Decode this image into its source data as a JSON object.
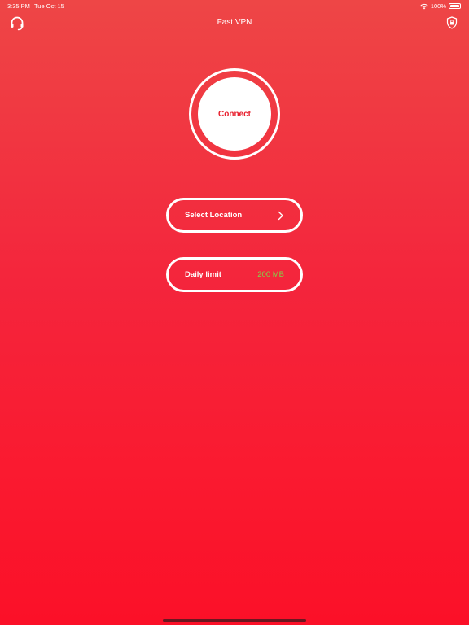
{
  "status_bar": {
    "time": "3:35 PM",
    "date": "Tue Oct 15",
    "battery_text": "100%",
    "battery_level": 1.0
  },
  "nav": {
    "title": "Fast VPN",
    "left_icon": "headset-icon",
    "right_icon": "shield-icon"
  },
  "connect": {
    "label": "Connect"
  },
  "location": {
    "label": "Select Location",
    "icon": "chevron-right-icon"
  },
  "limit": {
    "label": "Daily limit",
    "value": "200 MB"
  },
  "colors": {
    "background_top": "#ee4646",
    "background_bottom": "#fb1028",
    "accent": "#e8202e",
    "limit_value": "#7ed84a"
  }
}
